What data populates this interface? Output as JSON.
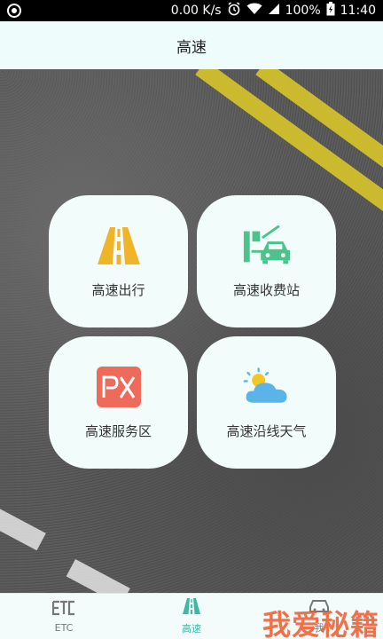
{
  "status_bar": {
    "speed": "0.00 K/s",
    "battery": "100%",
    "time": "11:40"
  },
  "header": {
    "title": "高速"
  },
  "cards": [
    {
      "label": "高速出行",
      "icon": "road-icon"
    },
    {
      "label": "高速收费站",
      "icon": "toll-station-icon"
    },
    {
      "label": "高速服务区",
      "icon": "px-service-area-icon"
    },
    {
      "label": "高速沿线天气",
      "icon": "weather-icon"
    }
  ],
  "bottom_nav": {
    "items": [
      {
        "label": "ETC",
        "icon": "etc-icon",
        "active": false
      },
      {
        "label": "高速",
        "icon": "road-icon",
        "active": true
      },
      {
        "label": "我",
        "icon": "car-icon",
        "active": false
      }
    ]
  },
  "watermark": "我爱秘籍",
  "colors": {
    "accent": "#3fb8a8",
    "card_bg": "#f2fdfb",
    "header_bg": "#eefcfb",
    "road_yellow": "#f0b429",
    "px_red": "#ee6a5a",
    "toll_green": "#4cc38a",
    "weather_blue": "#5ab4e8",
    "sun_yellow": "#f5c623"
  }
}
